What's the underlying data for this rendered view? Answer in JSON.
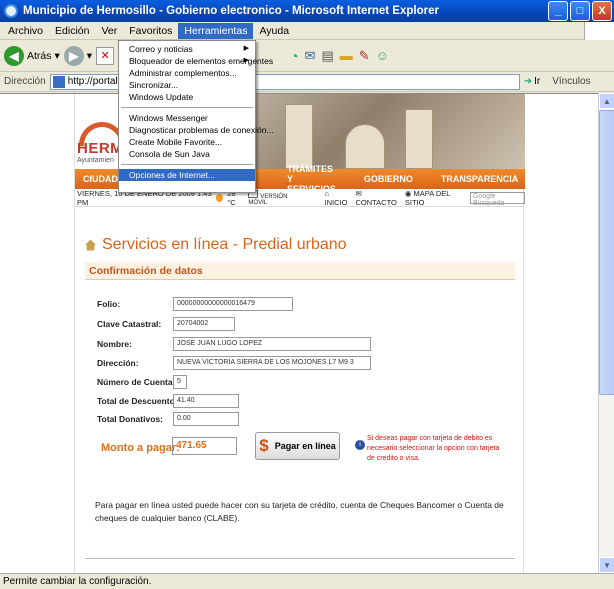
{
  "window": {
    "title": "Municipio de Hermosillo - Gobierno electronico - Microsoft Internet Explorer",
    "minimize": "_",
    "maximize": "□",
    "close": "X"
  },
  "menubar": {
    "items": [
      "Archivo",
      "Edición",
      "Ver",
      "Favoritos",
      "Herramientas",
      "Ayuda"
    ]
  },
  "toolbar": {
    "back_label": "Atrás"
  },
  "address": {
    "label": "Dirección",
    "url": "http://portalweb/servicio",
    "go_label": "Ir",
    "links_label": "Vínculos"
  },
  "tools_menu": {
    "items": [
      {
        "label": "Correo y noticias",
        "submenu": true
      },
      {
        "label": "Bloqueador de elementos emergentes",
        "submenu": true
      },
      {
        "label": "Administrar complementos...",
        "submenu": false
      },
      {
        "label": "Sincronizar...",
        "submenu": false
      },
      {
        "label": "Windows Update",
        "submenu": false
      },
      {
        "separator": true
      },
      {
        "label": "Windows Messenger",
        "submenu": false
      },
      {
        "label": "Diagnosticar problemas de conexión...",
        "submenu": false
      },
      {
        "label": "Create Mobile Favorite...",
        "submenu": false
      },
      {
        "label": "Consola de Sun Java",
        "submenu": false
      },
      {
        "separator": true
      },
      {
        "label": "Opciones de Internet...",
        "submenu": false,
        "highlighted": true
      }
    ]
  },
  "site": {
    "logo_text": "HERMO",
    "logo_sub": "Ayuntamien",
    "nav": [
      "CIUDADAN",
      "TRÁMITES Y SERVICIOS",
      "GOBIERNO",
      "TRANSPARENCIA"
    ],
    "date": "VIERNES, 16 DE ENERO DE 2009 1:43 PM",
    "temp": "28 °C",
    "version_movil": "VERSIÓN MÓVIL",
    "inicio": "INICIO",
    "contacto": "CONTACTO",
    "mapa": "MAPA DEL SITIO",
    "search_placeholder": "Google Búsqueda"
  },
  "content": {
    "title": "Servicios en línea - Predial urbano",
    "section": "Confirmación de datos",
    "fields": [
      {
        "label": "Folio:",
        "value": "00000000000000016479"
      },
      {
        "label": "Clave Catastral:",
        "value": "20704002"
      },
      {
        "label": "Nombre:",
        "value": "JOSE JUAN LUGO LOPEZ"
      },
      {
        "label": "Dirección:",
        "value": "NUEVA VICTORIA SIERRA DE LOS MOJONES L7 M9 3"
      },
      {
        "label": "Número de Cuentas:",
        "value": "5"
      },
      {
        "label": "Total de Descuentos:",
        "value": "41.40"
      },
      {
        "label": "Total Donativos:",
        "value": "0.00"
      }
    ],
    "monto_label": "Monto a pagar:",
    "monto_value": "471.65",
    "pay_button": "Pagar en línea",
    "note": "Si deseas pagar con tarjeta de debito es necesario seleccionar la opcion con tarjeta de credito o visa.",
    "pay_text": "Para pagar en línea usted puede hacer con su tarjeta de crédito, cuenta de Cheques Bancomer o Cuenta de cheques de cualquier banco (CLABE)."
  },
  "statusbar": {
    "text": "Permite cambiar la configuración."
  }
}
